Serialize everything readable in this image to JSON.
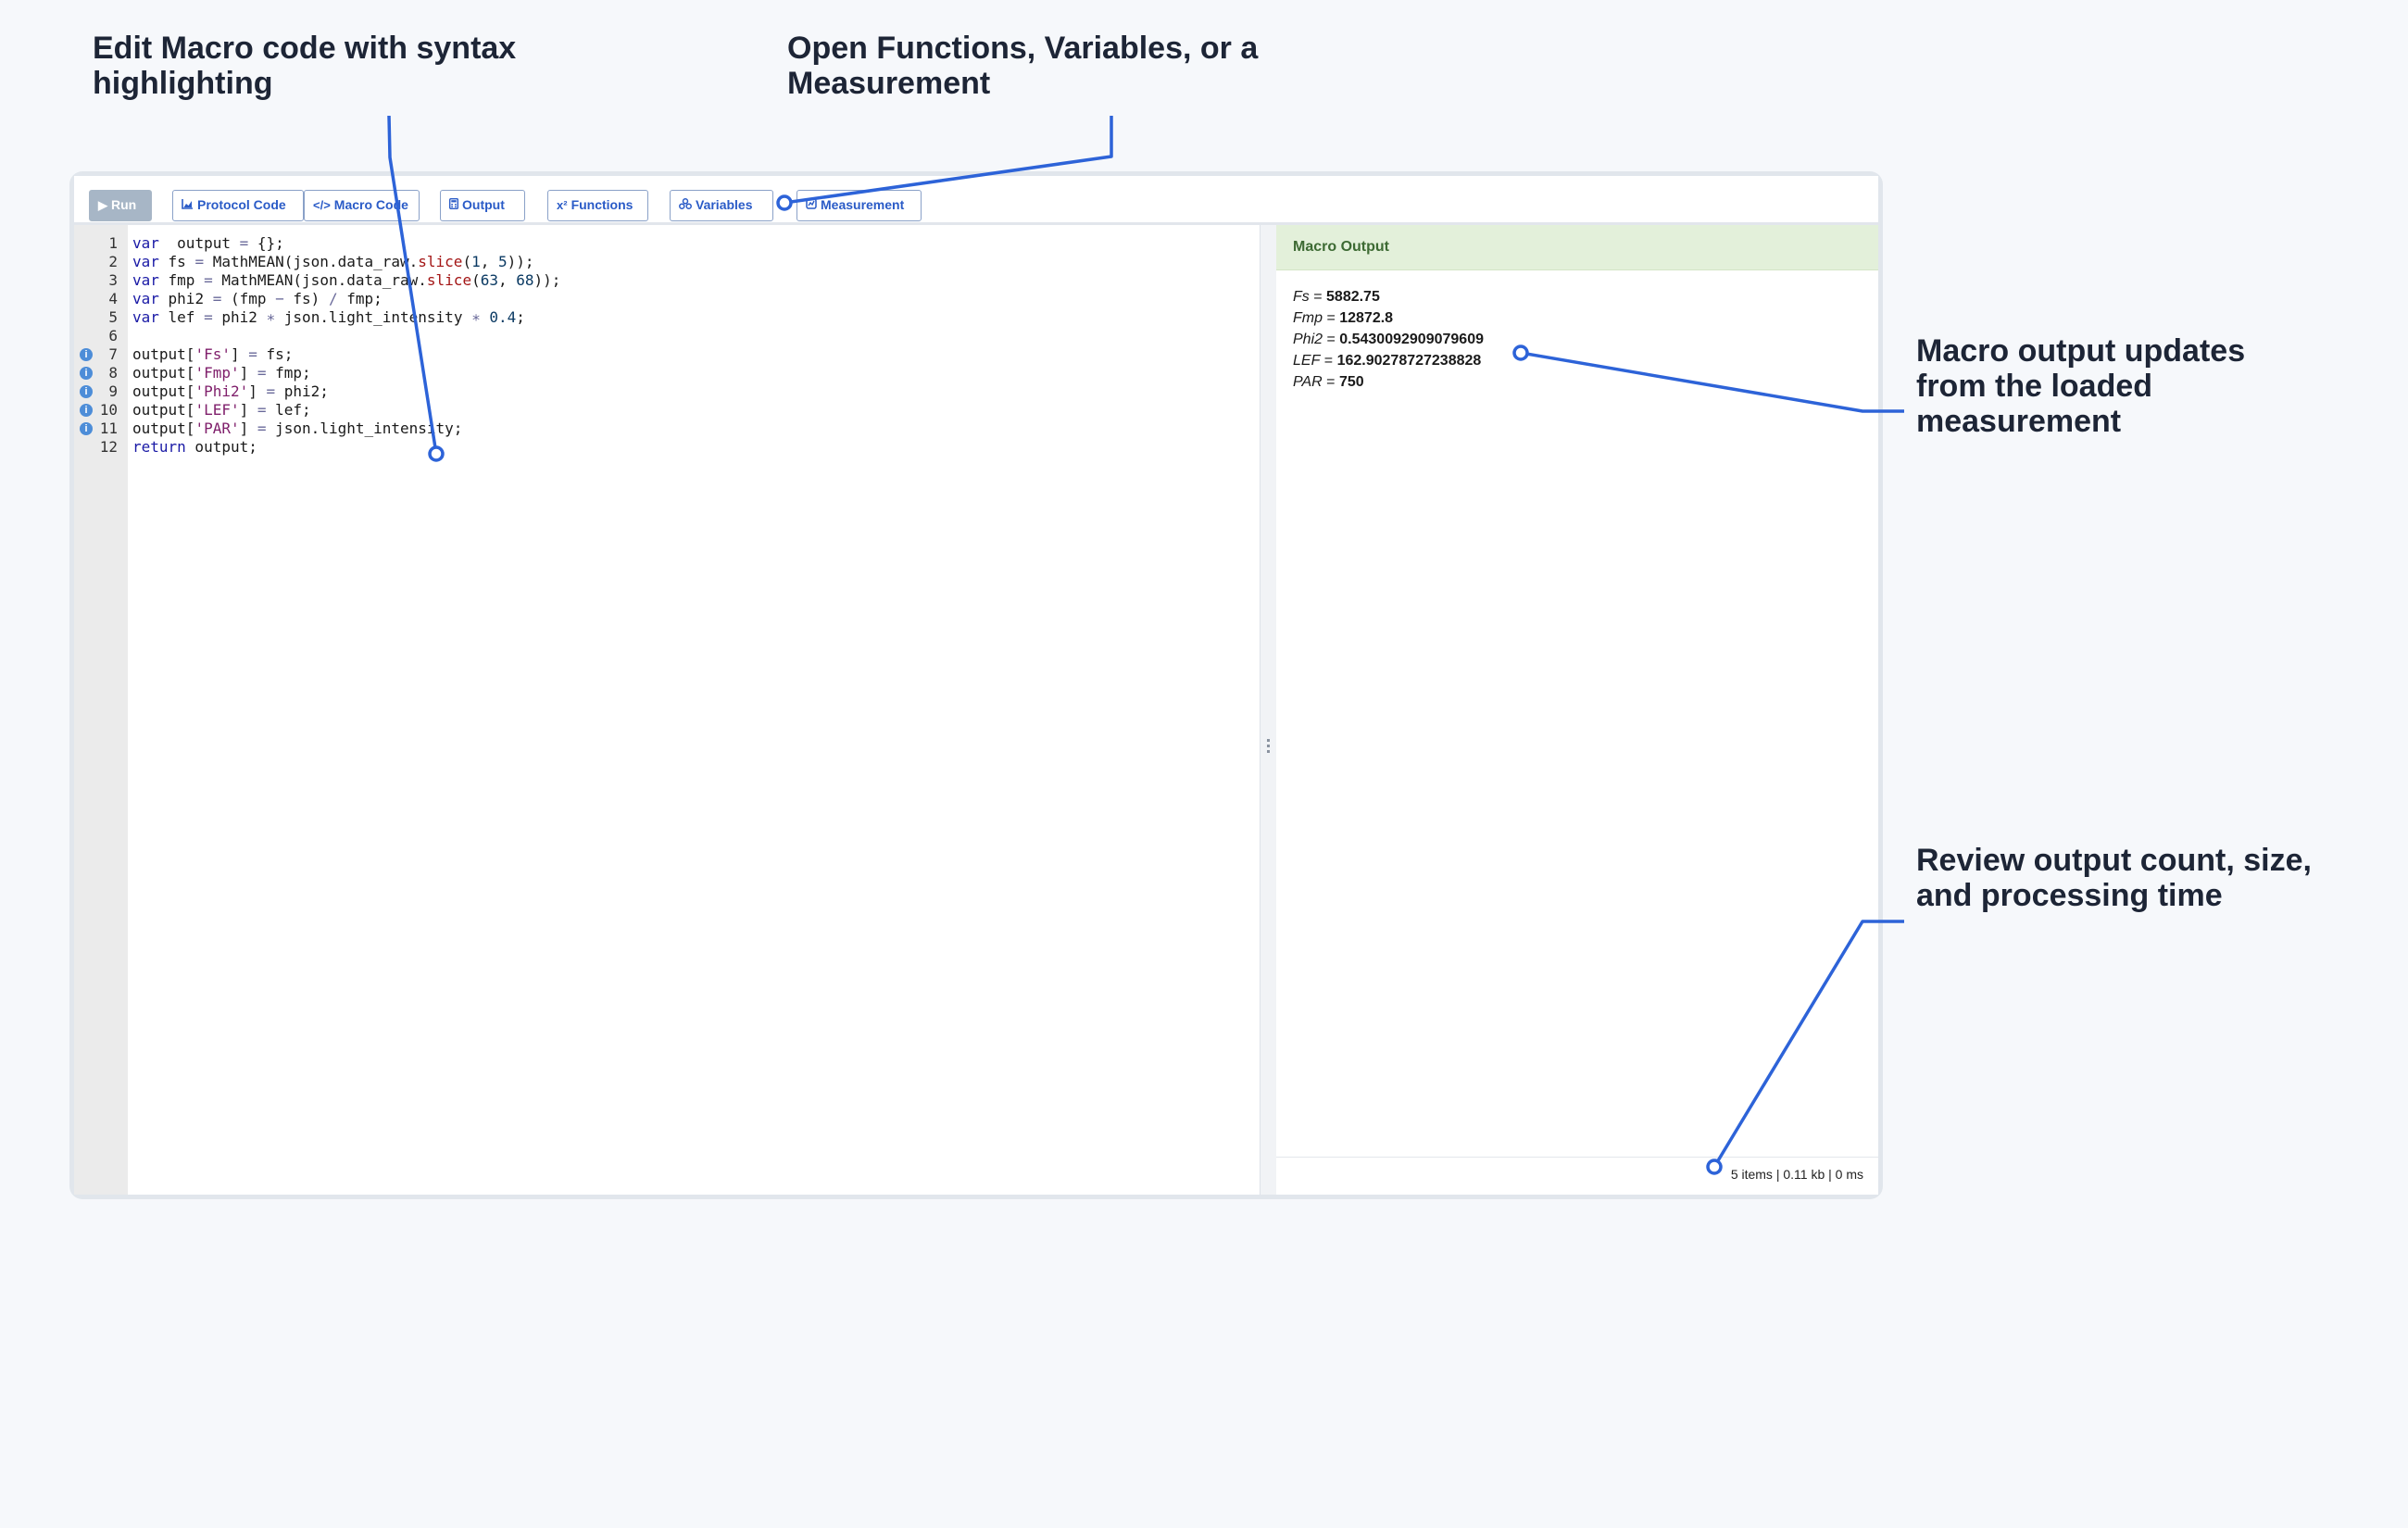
{
  "annotations": {
    "editor": "Edit Macro code with syntax highlighting",
    "toolbar": "Open Functions, Variables, or a Measurement",
    "output": "Macro output updates from the loaded measurement",
    "status": "Review output count, size, and processing time"
  },
  "toolbar": {
    "run": {
      "icon": "▶",
      "label": "Run"
    },
    "protocol_code": {
      "icon": "chart-icon",
      "label": "Protocol Code"
    },
    "macro_code": {
      "icon": "</>",
      "label": "Macro Code"
    },
    "output": {
      "icon": "calculator-icon",
      "label": "Output"
    },
    "functions": {
      "icon": "x²",
      "label": "Functions"
    },
    "variables": {
      "icon": "variables-icon",
      "label": "Variables"
    },
    "measurement": {
      "icon": "measurement-icon",
      "label": "Measurement"
    }
  },
  "editor": {
    "lines": [
      {
        "n": "1",
        "info": false,
        "tokens": [
          [
            "kw",
            "var"
          ],
          [
            "",
            "  output "
          ],
          [
            "op",
            "="
          ],
          [
            "",
            " {};"
          ]
        ]
      },
      {
        "n": "2",
        "info": false,
        "tokens": [
          [
            "kw",
            "var"
          ],
          [
            "",
            " fs "
          ],
          [
            "op",
            "="
          ],
          [
            "",
            " MathMEAN(json.data_raw."
          ],
          [
            "fn",
            "slice"
          ],
          [
            "",
            "("
          ],
          [
            "num",
            "1"
          ],
          [
            "",
            ", "
          ],
          [
            "num",
            "5"
          ],
          [
            "",
            "));"
          ]
        ]
      },
      {
        "n": "3",
        "info": false,
        "tokens": [
          [
            "kw",
            "var"
          ],
          [
            "",
            " fmp "
          ],
          [
            "op",
            "="
          ],
          [
            "",
            " MathMEAN(json.data_raw."
          ],
          [
            "fn",
            "slice"
          ],
          [
            "",
            "("
          ],
          [
            "num",
            "63"
          ],
          [
            "",
            ", "
          ],
          [
            "num",
            "68"
          ],
          [
            "",
            "));"
          ]
        ]
      },
      {
        "n": "4",
        "info": false,
        "tokens": [
          [
            "kw",
            "var"
          ],
          [
            "",
            " phi2 "
          ],
          [
            "op",
            "="
          ],
          [
            "",
            " (fmp "
          ],
          [
            "op",
            "−"
          ],
          [
            "",
            " fs) "
          ],
          [
            "op",
            "/"
          ],
          [
            "",
            " fmp;"
          ]
        ]
      },
      {
        "n": "5",
        "info": false,
        "tokens": [
          [
            "kw",
            "var"
          ],
          [
            "",
            " lef "
          ],
          [
            "op",
            "="
          ],
          [
            "",
            " phi2 "
          ],
          [
            "op",
            "∗"
          ],
          [
            "",
            " json.light_intensity "
          ],
          [
            "op",
            "∗"
          ],
          [
            "",
            " "
          ],
          [
            "num",
            "0.4"
          ],
          [
            "",
            ";"
          ]
        ]
      },
      {
        "n": "6",
        "info": false,
        "tokens": []
      },
      {
        "n": "7",
        "info": true,
        "tokens": [
          [
            "",
            "output["
          ],
          [
            "str",
            "'Fs'"
          ],
          [
            "",
            "] "
          ],
          [
            "op",
            "="
          ],
          [
            "",
            " fs;"
          ]
        ]
      },
      {
        "n": "8",
        "info": true,
        "tokens": [
          [
            "",
            "output["
          ],
          [
            "str",
            "'Fmp'"
          ],
          [
            "",
            "] "
          ],
          [
            "op",
            "="
          ],
          [
            "",
            " fmp;"
          ]
        ]
      },
      {
        "n": "9",
        "info": true,
        "tokens": [
          [
            "",
            "output["
          ],
          [
            "str",
            "'Phi2'"
          ],
          [
            "",
            "] "
          ],
          [
            "op",
            "="
          ],
          [
            "",
            " phi2;"
          ]
        ]
      },
      {
        "n": "10",
        "info": true,
        "tokens": [
          [
            "",
            "output["
          ],
          [
            "str",
            "'LEF'"
          ],
          [
            "",
            "] "
          ],
          [
            "op",
            "="
          ],
          [
            "",
            " lef;"
          ]
        ]
      },
      {
        "n": "11",
        "info": true,
        "tokens": [
          [
            "",
            "output["
          ],
          [
            "str",
            "'PAR'"
          ],
          [
            "",
            "] "
          ],
          [
            "op",
            "="
          ],
          [
            "",
            " json.light_intensity;"
          ]
        ]
      },
      {
        "n": "12",
        "info": false,
        "tokens": [
          [
            "kw",
            "return"
          ],
          [
            "",
            " output;"
          ]
        ]
      }
    ]
  },
  "output": {
    "title": "Macro Output",
    "rows": [
      {
        "key": "Fs",
        "value": "5882.75"
      },
      {
        "key": "Fmp",
        "value": "12872.8"
      },
      {
        "key": "Phi2",
        "value": "0.5430092909079609"
      },
      {
        "key": "LEF",
        "value": "162.90278727238828"
      },
      {
        "key": "PAR",
        "value": "750"
      }
    ],
    "status": "5 items | 0.11 kb | 0 ms"
  },
  "colors": {
    "accent": "#2a5bc7",
    "leader_line": "#2d63d8",
    "output_header_bg": "#e3f0da",
    "output_header_text": "#3d6a33",
    "run_button_bg": "#a7b6c6",
    "gutter_bg": "#ebebeb"
  }
}
